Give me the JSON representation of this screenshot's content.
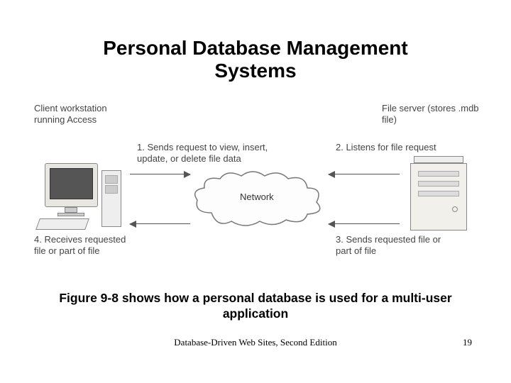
{
  "title_line1": "Personal Database Management",
  "title_line2": "Systems",
  "diagram": {
    "client_label": "Client workstation running Access",
    "server_label": "File server (stores .mdb file)",
    "network_label": "Network",
    "step1": "1. Sends request to view, insert, update, or delete file data",
    "step2": "2. Listens for file request",
    "step3": "3. Sends requested file or part of file",
    "step4": "4. Receives requested file or part of file"
  },
  "caption": "Figure 9-8 shows how a personal database is used for a multi-user application",
  "footer_source": "Database-Driven Web Sites, Second Edition",
  "page_number": "19"
}
